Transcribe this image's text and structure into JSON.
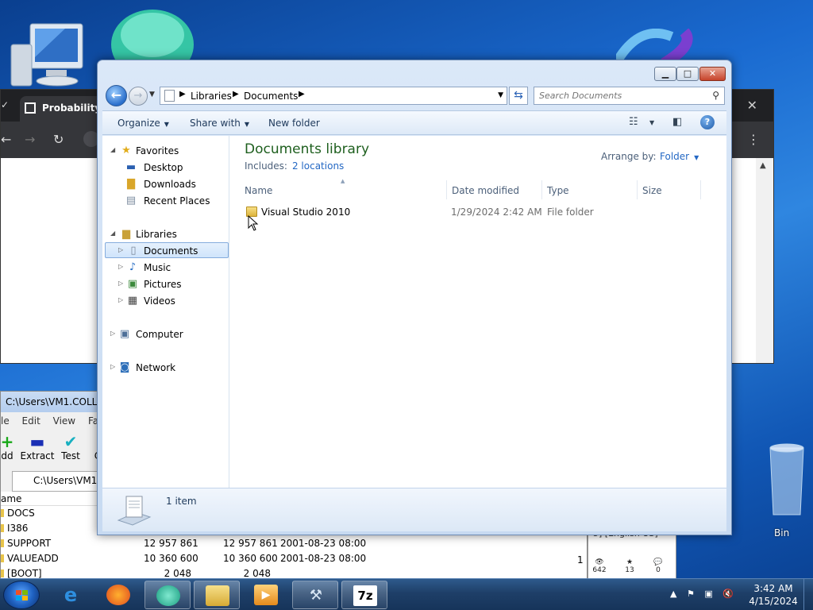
{
  "desktop": {
    "recycle_bin_label": "Bin"
  },
  "chrome_window": {
    "tab_title": "Probability C",
    "close_glyph": "✕",
    "back_glyph": "←",
    "forward_glyph": "→",
    "reload_glyph": "↻",
    "menu_glyph": "⋮",
    "scroll_up_glyph": "▲"
  },
  "zip_window": {
    "title": "C:\\Users\\VM1.COLLAB",
    "menu": [
      "le",
      "Edit",
      "View",
      "Favo"
    ],
    "tools": [
      {
        "label": "dd",
        "icon": "+",
        "color": "#18a818"
      },
      {
        "label": "Extract",
        "icon": "▬",
        "color": "#1a2fb5"
      },
      {
        "label": "Test",
        "icon": "✔",
        "color": "#18b0c0"
      },
      {
        "label": "C",
        "icon": "",
        "color": "#000000"
      }
    ],
    "path": "C:\\Users\\VM1.C",
    "list_header": "ame",
    "rows": [
      {
        "name": "DOCS",
        "size": "",
        "packed": "",
        "date": ""
      },
      {
        "name": "I386",
        "size": "",
        "packed": "",
        "date": ""
      },
      {
        "name": "SUPPORT",
        "size": "12 957 861",
        "packed": "12 957 861",
        "date": "2001-08-23 08:00"
      },
      {
        "name": "VALUEADD",
        "size": "10 360 600",
        "packed": "10 360 600",
        "date": "2001-08-23 08:00"
      },
      {
        "name": "[BOOT]",
        "size": "2 048",
        "packed": "2 048",
        "date": ""
      }
    ],
    "side_number": "1"
  },
  "widget": {
    "top_text": "5] [English US]",
    "stats": [
      {
        "icon": "👁",
        "value": "642"
      },
      {
        "icon": "★",
        "value": "13"
      },
      {
        "icon": "💬",
        "value": "0"
      }
    ]
  },
  "explorer": {
    "window_buttons": {
      "minimize": "▁",
      "maximize": "□",
      "close": "✕"
    },
    "breadcrumb": [
      "Libraries",
      "Documents"
    ],
    "search_placeholder": "Search Documents",
    "commands": {
      "organize": "Organize",
      "share_with": "Share with",
      "new_folder": "New folder"
    },
    "nav": {
      "favorites_header": "Favorites",
      "favorites": [
        "Desktop",
        "Downloads",
        "Recent Places"
      ],
      "libraries_header": "Libraries",
      "libraries": [
        "Documents",
        "Music",
        "Pictures",
        "Videos"
      ],
      "computer": "Computer",
      "network": "Network",
      "selected": "Documents"
    },
    "library": {
      "title": "Documents library",
      "includes_label": "Includes:",
      "includes_link": "2 locations",
      "arrange_label": "Arrange by:",
      "arrange_value": "Folder"
    },
    "columns": [
      "Name",
      "Date modified",
      "Type",
      "Size"
    ],
    "files": [
      {
        "name": "Visual Studio 2010",
        "date": "1/29/2024 2:42 AM",
        "type": "File folder",
        "size": ""
      }
    ],
    "status": "1 item"
  },
  "taskbar": {
    "apps": [
      "Internet Explorer",
      "Firefox",
      "App",
      "Windows Explorer",
      "Media Player",
      "Tool",
      "7-Zip"
    ],
    "tray_icons": [
      "show-hidden-icon",
      "flag-icon",
      "network-icon",
      "volume-muted-icon"
    ],
    "time": "3:42 AM",
    "date": "4/15/2024",
    "sevenzip_label": "7z"
  },
  "colors": {
    "library_title": "#1e5f1e",
    "link": "#2468c4",
    "taskbar": "#1e3f68"
  }
}
